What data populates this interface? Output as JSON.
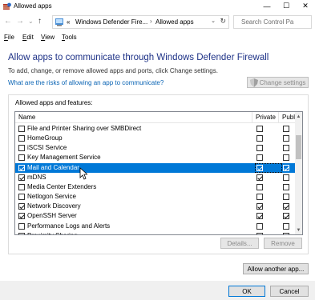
{
  "window": {
    "title": "Allowed apps",
    "controls": {
      "minimize": "—",
      "maximize": "☐",
      "close": "✕"
    }
  },
  "address_bar": {
    "back_icon": "←",
    "forward_icon": "→",
    "recent_icon": "⌄",
    "up_icon": "↑",
    "overflow": "«",
    "segments": [
      "Windows Defender Fire...",
      "Allowed apps"
    ],
    "separator": "›",
    "dropdown_icon": "⌄",
    "refresh_icon": "↻",
    "search_placeholder": "Search Control Pa"
  },
  "menu": [
    {
      "label": "File",
      "key": "F",
      "rest": "ile"
    },
    {
      "label": "Edit",
      "key": "E",
      "rest": "dit"
    },
    {
      "label": "View",
      "key": "V",
      "rest": "iew"
    },
    {
      "label": "Tools",
      "key": "T",
      "rest": "ools"
    }
  ],
  "main": {
    "heading": "Allow apps to communicate through Windows Defender Firewall",
    "subtext": "To add, change, or remove allowed apps and ports, click Change settings.",
    "risk_link": "What are the risks of allowing an app to communicate?",
    "change_settings": "Change settings",
    "group_label": "Allowed apps and features:",
    "columns": {
      "name": "Name",
      "private": "Private",
      "public": "Public"
    },
    "rows": [
      {
        "name": "File and Printer Sharing over SMBDirect",
        "checked": false,
        "private": false,
        "public": false
      },
      {
        "name": "HomeGroup",
        "checked": false,
        "private": false,
        "public": false,
        "dim": true
      },
      {
        "name": "iSCSI Service",
        "checked": false,
        "private": false,
        "public": false
      },
      {
        "name": "Key Management Service",
        "checked": false,
        "private": false,
        "public": false
      },
      {
        "name": "Mail and Calendar",
        "checked": true,
        "private": true,
        "public": true,
        "selected": true
      },
      {
        "name": "mDNS",
        "checked": true,
        "private": true,
        "public": false
      },
      {
        "name": "Media Center Extenders",
        "checked": false,
        "private": false,
        "public": false
      },
      {
        "name": "Netlogon Service",
        "checked": false,
        "private": false,
        "public": false
      },
      {
        "name": "Network Discovery",
        "checked": true,
        "private": true,
        "public": true
      },
      {
        "name": "OpenSSH Server",
        "checked": true,
        "private": true,
        "public": true
      },
      {
        "name": "Performance Logs and Alerts",
        "checked": false,
        "private": false,
        "public": false
      },
      {
        "name": "Proximity Sharing",
        "checked": true,
        "private": true,
        "public": true
      }
    ],
    "details_button": "Details...",
    "remove_button": "Remove",
    "allow_another_button": "Allow another app..."
  },
  "footer": {
    "ok_button": "OK",
    "cancel_button": "Cancel"
  },
  "colors": {
    "heading": "#1e3287",
    "link": "#0a64b4",
    "selection": "#0078d7"
  }
}
